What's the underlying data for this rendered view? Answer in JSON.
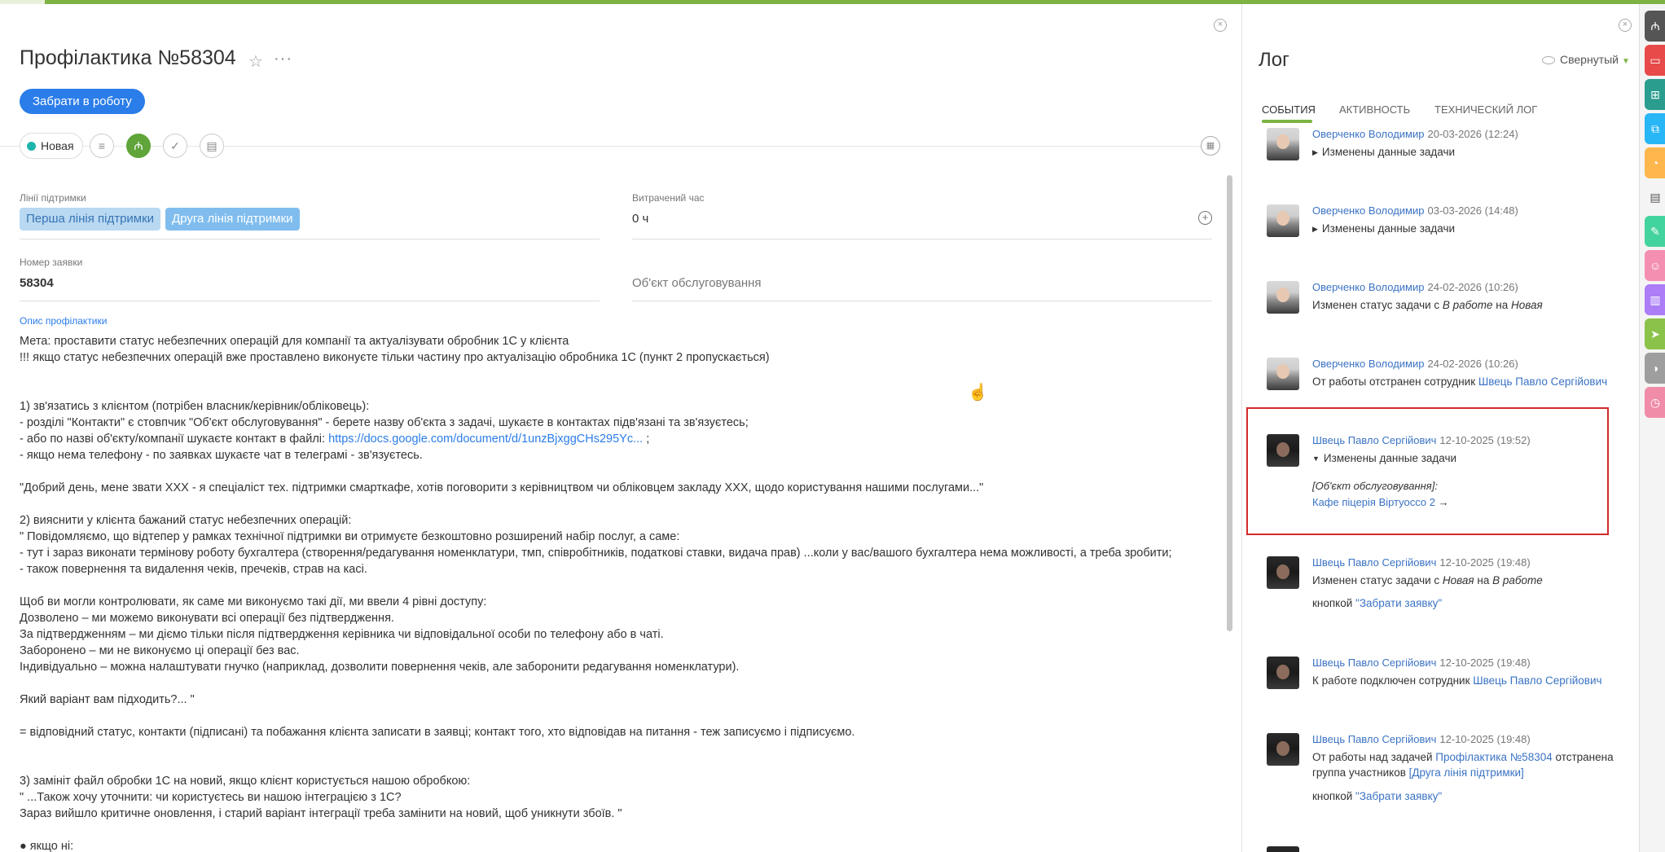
{
  "task": {
    "title": "Профілактика №58304",
    "take_button": "Забрати в роботу",
    "status": "Новая",
    "fields": {
      "support_lines_label": "Лінії підтримки",
      "support_lines": [
        "Перша лінія підтримки",
        "Друга лінія підтримки"
      ],
      "time_spent_label": "Витрачений час",
      "time_spent_value": "0 ч",
      "request_number_label": "Номер заявки",
      "request_number_value": "58304",
      "service_object_placeholder": "Об'єкт обслуговування"
    },
    "description_label": "Опис профілактики",
    "description": {
      "line_01": "Мета: проставити статус небезпечних операцій для компанії та актуалізувати обробник 1С у клієнта",
      "line_02": "!!! якщо статус небезпечних операцій вже проставлено виконуєте тільки частину про актуалізацію обробника 1С (пункт 2 пропускається)",
      "line_03": "1) зв'язатись з клієнтом (потрібен власник/керівник/обліковець):",
      "line_04": "- розділі \"Контакти\" є стовпчик \"Об'єкт обслуговування\" - берете назву об'єкта з задачі, шукаєте в контактах підв'язані та зв'язуєтесь;",
      "line_05_text": "- або по назві об'єкту/компанії шукаєте контакт в файлі: ",
      "line_05_link": "https://docs.google.com/document/d/1unzBjxggCHs295Yc...",
      "line_05_tail": " ;",
      "line_06": "- якщо нема телефону - по заявках шукаєте чат в телеграмі - зв'язуєтесь.",
      "line_07": "\"Добрий день, мене звати ХХХ - я спеціаліст тех. підтримки смарткафе, хотів поговорити з керівництвом чи обліковцем закладу ХХХ, щодо користування нашими послугами...\"",
      "line_08": "2) вияснити у клієнта бажаний статус небезпечних операцій:",
      "line_09": "\" Повідомляємо, що відтепер у рамках технічної підтримки ви отримуєте безкоштовно розширений набір послуг, а саме:",
      "line_10": "- тут і зараз виконати термінову роботу бухгалтера (створення/редагування номенклатури, тмп, співробітників, податкові ставки, видача прав) ...коли у вас/вашого бухгалтера нема можливості, а треба зробити;",
      "line_11": "- також повернення та видалення чеків, пречеків, страв на касі.",
      "line_12": "Щоб ви могли контролювати, як саме ми виконуємо такі дії, ми ввели 4 рівні доступу:",
      "line_13": "Дозволено – ми можемо виконувати всі операції без підтвердження.",
      "line_14": "За підтвердженням – ми діємо тільки після підтвердження керівника чи відповідальної особи по телефону або в чаті.",
      "line_15": "Заборонено – ми не виконуємо ці операції без вас.",
      "line_16": "Індивідуально – можна налаштувати гнучко (наприклад, дозволити повернення чеків, але заборонити редагування номенклатури).",
      "line_17": "Який варіант вам підходить?... \"",
      "line_18": "= відповідний статус, контакти (підписані) та побажання клієнта записати в заявці; контакт того, хто відповідав на питання - теж записуємо і підписуємо.",
      "line_19": "3) замініт файл обробки 1С на новий, якщо клієнт користується нашою обробкою:",
      "line_20": "\" ...Також хочу уточнити: чи користуєтесь ви нашою інтеграцією з 1С?",
      "line_21": "Зараз вийшло критичне оновлення, і старий варіант інтеграції треба замінити на новий, щоб уникнути збоїв. \"",
      "line_22": "● якщо ні:"
    }
  },
  "log": {
    "title": "Лог",
    "collapse_label": "Свернутый",
    "tabs": [
      "СОБЫТИЯ",
      "АКТИВНОСТЬ",
      "ТЕХНИЧЕСКИЙ ЛОГ"
    ],
    "entries": [
      {
        "author": "Оверченко Володимир",
        "date": "20-03-2026 (12:24)",
        "text": "Изменены данные задачи"
      },
      {
        "author": "Оверченко Володимир",
        "date": "03-03-2026 (14:48)",
        "text": "Изменены данные задачи"
      },
      {
        "author": "Оверченко Володимир",
        "date": "24-02-2026 (10:26)",
        "text_a": "Изменен статус задачи  с ",
        "from": "В работе",
        "mid": " на ",
        "to": "Новая"
      },
      {
        "author": "Оверченко Володимир",
        "date": "24-02-2026 (10:26)",
        "text_a": "От работы отстранен сотрудник ",
        "link": "Швець Павло Сергійович"
      },
      {
        "author": "Швець Павло Сергійович",
        "date": "12-10-2025 (19:52)",
        "text": "Изменены данные задачи",
        "field": "[Об'єкт обслуговування]:",
        "value": "Кафе піцерія Віртуоссо 2",
        "arrow": "→"
      },
      {
        "author": "Швець Павло Сергійович",
        "date": "12-10-2025 (19:48)",
        "text_a": "Изменен статус задачи  с ",
        "from": "Новая",
        "mid": " на ",
        "to": "В работе",
        "button_prefix": "кнопкой ",
        "button_name": "\"Забрати заявку\""
      },
      {
        "author": "Швець Павло Сергійович",
        "date": "12-10-2025 (19:48)",
        "text_a": "К работе подключен сотрудник ",
        "link": "Швець Павло Сергійович"
      },
      {
        "author": "Швець Павло Сергійович",
        "date": "12-10-2025 (19:48)",
        "text_a": "От работы над задачей ",
        "link": "Профілактика №58304",
        "text_b": " отстранена",
        "line2_a": "группа участников ",
        "line2_link": "[Друга лінія підтримки]",
        "button_prefix": "кнопкой ",
        "button_name": "\"Забрати заявку\""
      }
    ]
  },
  "colors": {
    "accent_green": "#7cb342",
    "primary_blue": "#2b7de9",
    "highlight_red": "#d32a2a"
  },
  "rail_icons": [
    "crm-icon",
    "chat-icon",
    "org-icon",
    "copy-icon",
    "bell-icon",
    "doc-icon",
    "key-icon",
    "contacts-icon",
    "stats-icon",
    "send-icon",
    "chart-icon",
    "clock-icon"
  ],
  "rail_colors": [
    "#555555",
    "#e84a4a",
    "#2a9d8f",
    "#29b6f6",
    "#ffb74d",
    "#f4f4f4",
    "#43d39e",
    "#f48fb1",
    "#ab7df6",
    "#8bc34a",
    "#9e9e9e",
    "#f08ca8"
  ]
}
